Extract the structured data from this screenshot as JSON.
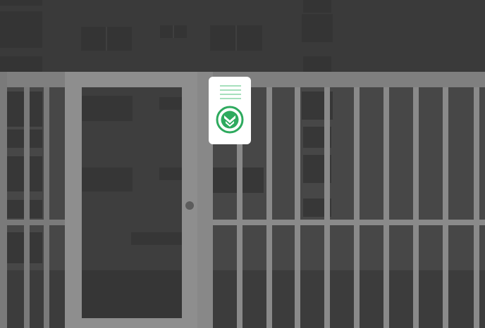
{
  "scene": {
    "description_visible_text": "",
    "colors": {
      "background_dark": "#3d3d3d",
      "building_shade": "#333333",
      "window_dark": "#2c2c2c",
      "fence_light": "#8a8a8a",
      "fence_mid": "#6e6e6e",
      "gate_glass": "#3a3a3a",
      "knob": "#5a5a5a",
      "badge_bg": "#ffffff",
      "badge_accent": "#2eaa5e",
      "badge_lines": "#4cc27a"
    },
    "icons": {
      "badge_icon": "shield-check-icon",
      "door_knob": "door-knob-icon"
    }
  }
}
